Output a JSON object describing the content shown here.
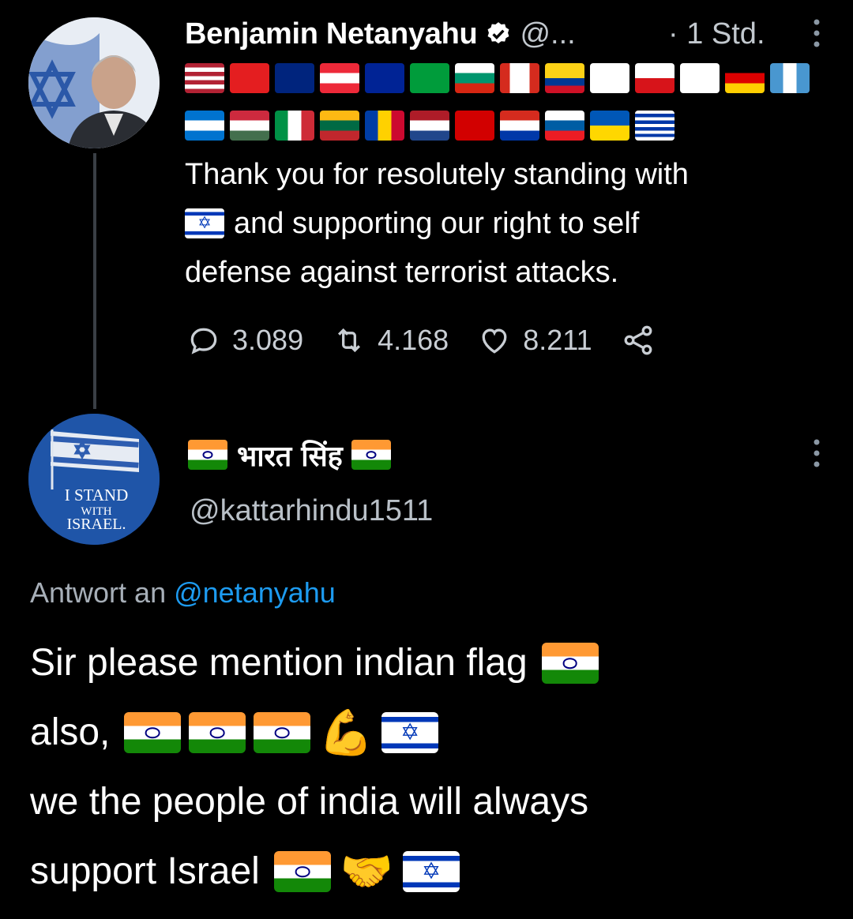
{
  "tweet": {
    "author_name": "Benjamin Netanyahu",
    "handle": "@...",
    "time": "· 1 Std.",
    "flags_row1": [
      "us",
      "al",
      "au",
      "at",
      "ba",
      "br",
      "bg",
      "ca",
      "co",
      "cy",
      "cz",
      "ge",
      "de",
      "gt"
    ],
    "flags_row2": [
      "hn",
      "hu",
      "it",
      "lt",
      "md",
      "nl",
      "mk",
      "py",
      "si",
      "ua",
      "uy"
    ],
    "text_line1": "Thank you for resolutely standing with",
    "text_line2": "and supporting our right to self",
    "text_line3": "defense against terrorist attacks.",
    "replies": "3.089",
    "retweets": "4.168",
    "likes": "8.211"
  },
  "reply": {
    "display_name": "भारत सिंह",
    "handle": "@kattarhindu1511",
    "replying_prefix": "Antwort an",
    "replying_to": "@netanyahu",
    "avatar_text": [
      "I STAND",
      "WITH",
      "ISRAEL."
    ],
    "line1": "Sir please mention indian flag",
    "line2": "also,",
    "line3": "we the people of india will always",
    "line4": "support Israel",
    "flexed_emoji": "💪",
    "handshake_emoji": "🤝"
  },
  "colors": {
    "background": "#000000",
    "muted": "#8b98a5",
    "link": "#1d9bf0",
    "verified": "#ffffff"
  }
}
